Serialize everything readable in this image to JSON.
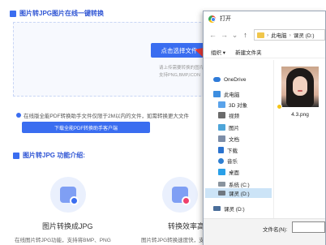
{
  "background_page": {
    "section_title": "图片转JPG图片在线一键转换",
    "upload_button": "点击选择文件",
    "hint_line1": "请上传需要转换的图片",
    "hint_line2": "支持PNG,BMP,ICON",
    "info_text": "在线版全能PDF转换助手文件仅限于2M以内的文件，如需转换更大文件",
    "download_button": "下载全能PDF转换助手客户端",
    "features_title": "图片转JPG 功能介绍:",
    "feature1_title": "图片转换成JPG",
    "feature1_desc": "在线图片转JPG功能，支持将BMP、PNG",
    "feature2_title": "转换效率高",
    "feature2_desc": "图片转JPG转换速度快，支持批",
    "colors": {
      "accent": "#3a6df0",
      "arrow": "#e53935"
    }
  },
  "dialog": {
    "title": "打开",
    "nav": {
      "back": "←",
      "forward": "→",
      "dropdown": "⌄",
      "up": "↑"
    },
    "address": {
      "segment1": "此电脑",
      "separator": "›",
      "segment2": "课灵 (D:)"
    },
    "toolbar": {
      "organize": "组织 ▾",
      "new_folder": "新建文件夹"
    },
    "tree": [
      {
        "label": "OneDrive",
        "icon": "cloud-icon"
      },
      {
        "label": "此电脑",
        "icon": "computer-icon"
      },
      {
        "label": "3D 对象",
        "icon": "3d-objects-icon"
      },
      {
        "label": "视频",
        "icon": "video-icon"
      },
      {
        "label": "图片",
        "icon": "pictures-icon"
      },
      {
        "label": "文档",
        "icon": "documents-icon"
      },
      {
        "label": "下载",
        "icon": "download-icon"
      },
      {
        "label": "音乐",
        "icon": "music-icon"
      },
      {
        "label": "桌面",
        "icon": "desktop-icon"
      },
      {
        "label": "系统 (C:)",
        "icon": "drive-c-icon"
      },
      {
        "label": "课灵 (D:)",
        "icon": "drive-d-icon"
      },
      {
        "label": "课灵 (D:)",
        "icon": "drive-d-icon"
      }
    ],
    "file": {
      "name": "4.3.png"
    },
    "filename_label": "文件名(N):",
    "filename_value": ""
  }
}
